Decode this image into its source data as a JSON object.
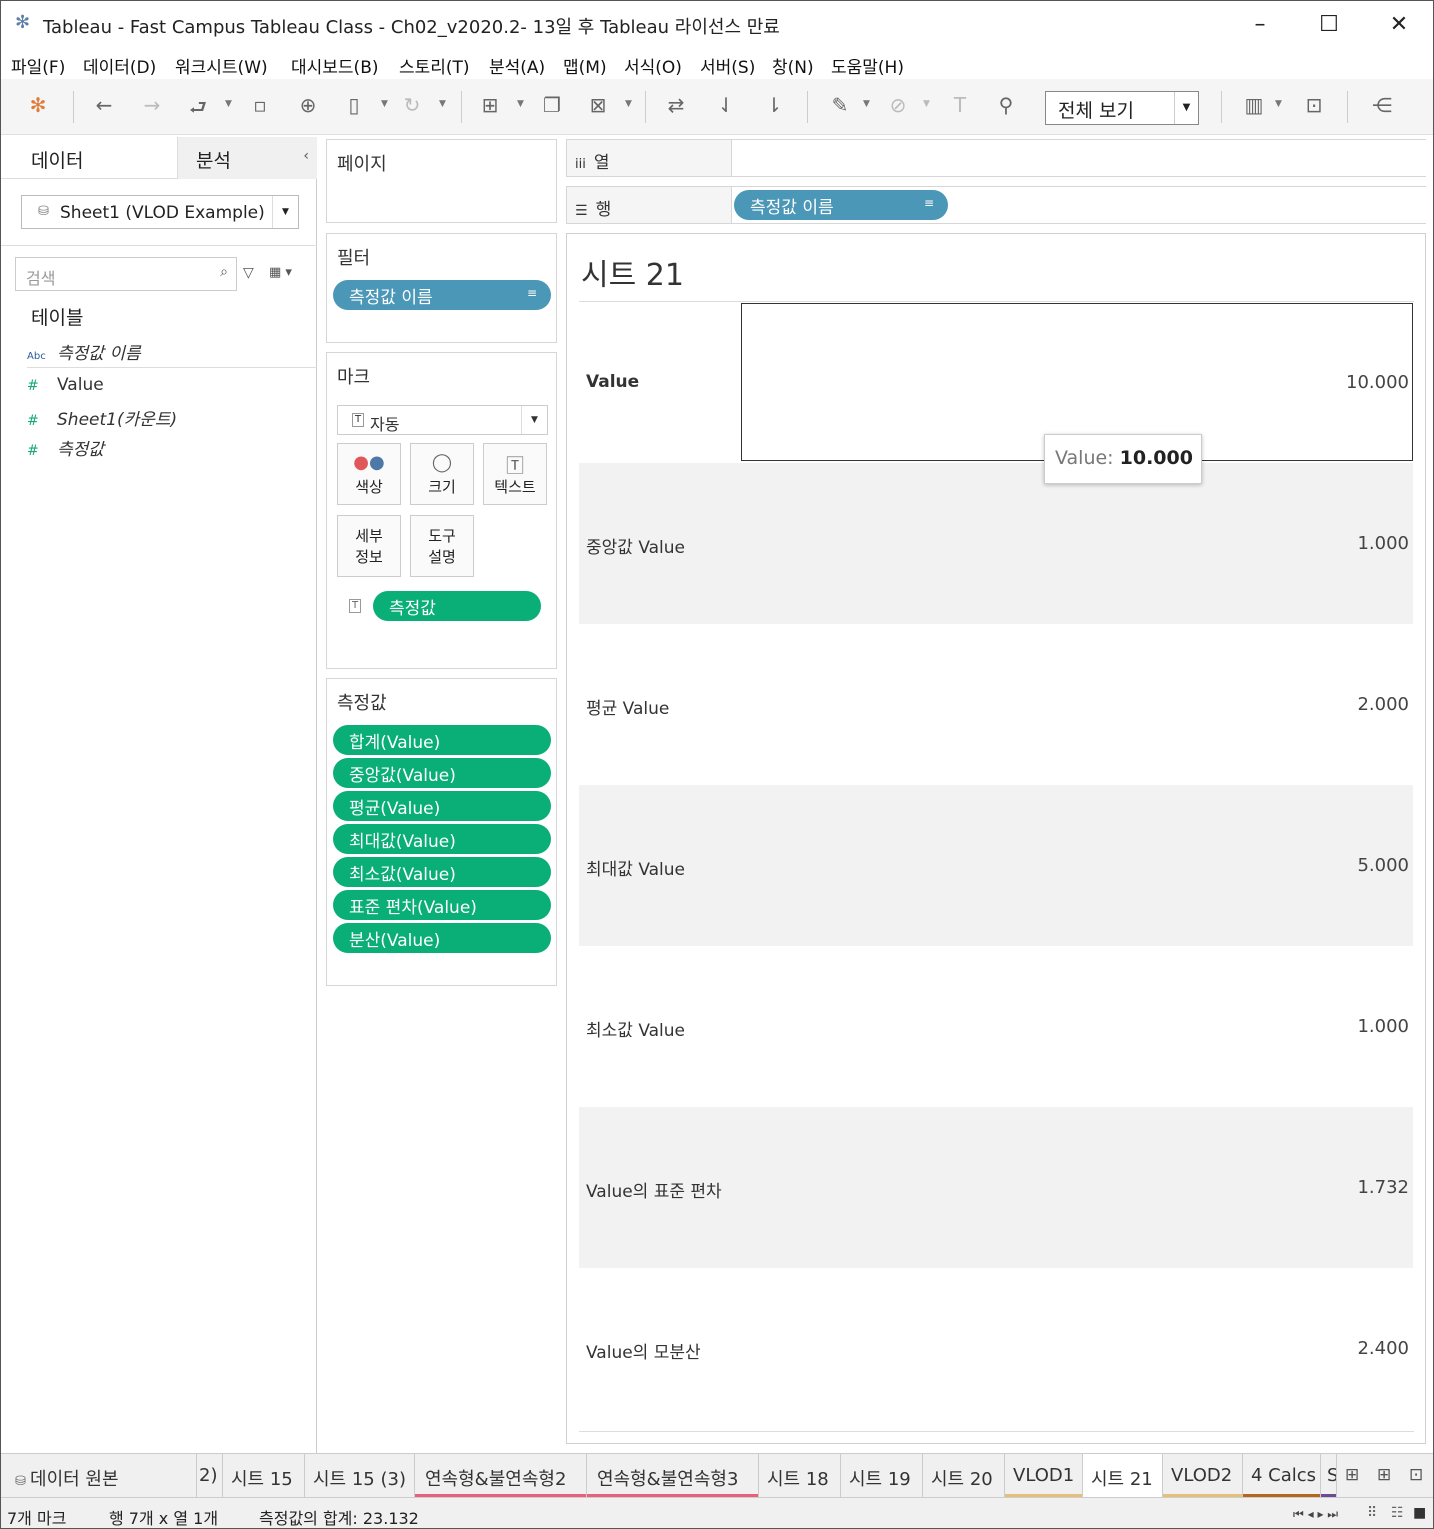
{
  "window": {
    "title": "Tableau - Fast Campus Tableau Class - Ch02_v2020.2- 13일 후 Tableau 라이선스 만료"
  },
  "menu": [
    "파일(F)",
    "데이터(D)",
    "워크시트(W)",
    "대시보드(B)",
    "스토리(T)",
    "분석(A)",
    "맵(M)",
    "서식(O)",
    "서버(S)",
    "창(N)",
    "도움말(H)"
  ],
  "toolbar": {
    "view_select": "전체 보기"
  },
  "left_panel": {
    "tab_data": "데이터",
    "tab_analysis": "분석",
    "datasource": "Sheet1 (VLOD Example)",
    "search_placeholder": "검색",
    "section": "테이블",
    "fields": [
      {
        "type": "Abc",
        "name": "측정값 이름"
      },
      {
        "type": "#",
        "name": "Value"
      },
      {
        "type": "#",
        "name": "Sheet1(카운트)"
      },
      {
        "type": "#",
        "name": "측정값"
      }
    ]
  },
  "pages": {
    "title": "페이지"
  },
  "filters": {
    "title": "필터",
    "pill": "측정값 이름"
  },
  "marks": {
    "title": "마크",
    "type": "자동",
    "buttons": {
      "color": "색상",
      "size": "크기",
      "text": "텍스트",
      "detail": "세부 정보",
      "tooltip": "도구 설명"
    },
    "detail_l1": "세부",
    "detail_l2": "정보",
    "tooltip_l1": "도구",
    "tooltip_l2": "설명",
    "text_pill": "측정값"
  },
  "measures": {
    "title": "측정값",
    "pills": [
      "합계(Value)",
      "중앙값(Value)",
      "평균(Value)",
      "최대값(Value)",
      "최소값(Value)",
      "표준 편차(Value)",
      "분산(Value)"
    ]
  },
  "shelves": {
    "columns_label": "열",
    "rows_label": "행",
    "rows_pill": "측정값 이름"
  },
  "view": {
    "sheet_title": "시트 21",
    "rows": [
      {
        "label": "Value",
        "value": "10.000"
      },
      {
        "label": "중앙값 Value",
        "value": "1.000"
      },
      {
        "label": "평균 Value",
        "value": "2.000"
      },
      {
        "label": "최대값 Value",
        "value": "5.000"
      },
      {
        "label": "최소값 Value",
        "value": "1.000"
      },
      {
        "label": "Value의 표준 편차",
        "value": "1.732"
      },
      {
        "label": "Value의 모분산",
        "value": "2.400"
      }
    ],
    "tooltip": {
      "label": "Value:",
      "value": "10.000"
    }
  },
  "sheet_tabs": {
    "datasource_tab": "데이터 원본",
    "tabs": [
      "2)",
      "시트 15",
      "시트 15 (3)",
      "연속형&불연속형2",
      "연속형&불연속형3",
      "시트 18",
      "시트 19",
      "시트 20",
      "VLOD1",
      "시트 21",
      "VLOD2",
      "4 Calcs",
      "S"
    ],
    "active": "시트 21",
    "colors": {
      "pink": "#e8607a",
      "gold": "#e5c07b",
      "brown": "#b5651d",
      "purple": "#6a4c93"
    }
  },
  "status": {
    "marks": "7개 마크",
    "rowscols": "행 7개 x 열 1개",
    "sum": "측정값의 합계: 23.132"
  }
}
